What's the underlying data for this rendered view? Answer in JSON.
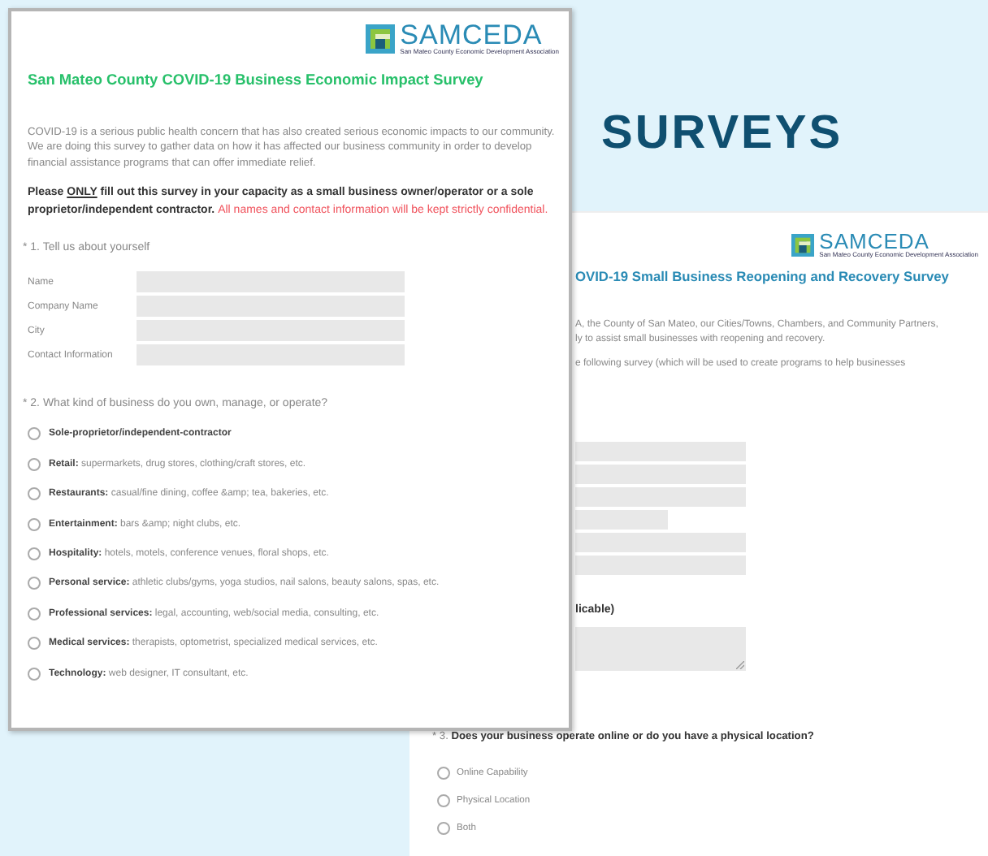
{
  "heading": "SURVEYS",
  "front_survey": {
    "logo": {
      "name": "SAMCEDA",
      "subtitle": "San Mateo County Economic Development Association"
    },
    "title": "San Mateo County COVID-19 Business Economic Impact Survey",
    "intro": "COVID-19 is a serious public health concern that has also created serious economic impacts to our community. We are doing this survey to gather data on how it has affected our business community in order to develop financial assistance programs that can offer immediate relief.",
    "notice_parts": [
      {
        "text": "Please",
        "underline": false
      },
      {
        "text": "ONLY",
        "underline": true
      },
      {
        "text": "fill out this survey in your capacity as a small business owner/operator or a sole proprietor/independent contractor.",
        "underline": false
      }
    ],
    "confidential": "All names and contact information will be kept strictly confidential.",
    "q1": {
      "label": "* 1. Tell us about yourself",
      "fields": [
        {
          "label": "Name"
        },
        {
          "label": "Company Name"
        },
        {
          "label": "City"
        },
        {
          "label": "Contact Information"
        }
      ]
    },
    "q2": {
      "label": "* 2. What kind of business do you own, manage, or operate?",
      "options": [
        {
          "text": "**Sole-proprietor/independent-contractor**",
          "selected": false
        },
        {
          "text": "**Retail:** supermarkets, drug stores, clothing/craft stores, etc.",
          "selected": false
        },
        {
          "text": "**Restaurants:** casual/fine dining, coffee &amp; tea, bakeries, etc.",
          "selected": false
        },
        {
          "text": "**Entertainment:** bars &amp; night clubs, etc.",
          "selected": false
        },
        {
          "text": "**Hospitality:** hotels, motels, conference venues, floral shops, etc.",
          "selected": false
        },
        {
          "text": "**Personal service:** athletic clubs/gyms, yoga studios, nail salons, beauty salons, spas, etc.",
          "selected": false
        },
        {
          "text": "**Professional services:** legal, accounting, web/social media, consulting, etc.",
          "selected": false
        },
        {
          "text": "**Medical services:** therapists, optometrist, specialized medical services, etc.",
          "selected": false
        },
        {
          "text": "**Technology:** web designer, IT consultant, etc.",
          "selected": false
        }
      ]
    }
  },
  "back_survey": {
    "logo": {
      "name": "SAMCEDA",
      "subtitle": "San Mateo County Economic Development Association"
    },
    "title": "OVID-19 Small Business Reopening and Recovery Survey",
    "intro_lines": [
      "A, the County of San Mateo, our Cities/Towns,  Chambers, and Community Partners,",
      "ly to assist small businesses with reopening and recovery."
    ],
    "survey_line": "e following survey (which will be used to create programs to help businesses",
    "fields": [
      {
        "kind": "full"
      },
      {
        "kind": "full"
      },
      {
        "kind": "full"
      },
      {
        "kind": "short"
      },
      {
        "kind": "full"
      },
      {
        "kind": "full"
      }
    ],
    "textarea_label": "licable)",
    "q3": {
      "number": "* 3.",
      "label": "Does your business operate online or do you have a physical location?",
      "options": [
        {
          "text": "Online Capability",
          "selected": false
        },
        {
          "text": "Physical Location",
          "selected": false
        },
        {
          "text": "Both",
          "selected": false
        }
      ]
    }
  }
}
